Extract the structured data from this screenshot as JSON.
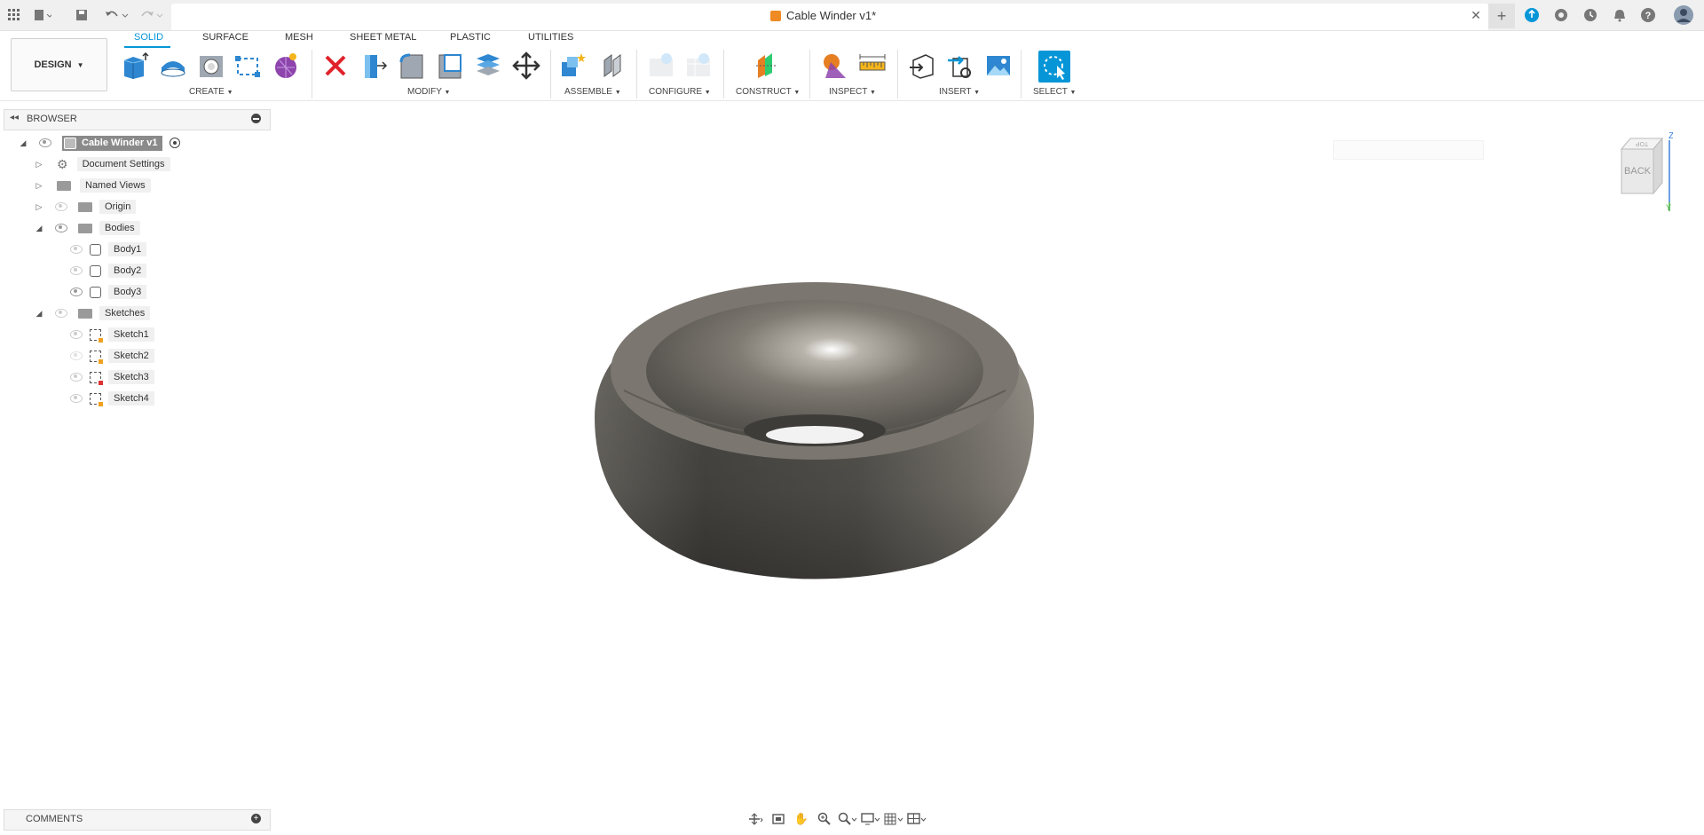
{
  "window": {
    "document_title": "Cable Winder v1*"
  },
  "workspace": {
    "design_label": "DESIGN"
  },
  "tabs": [
    {
      "label": "SOLID",
      "active": true
    },
    {
      "label": "SURFACE",
      "active": false
    },
    {
      "label": "MESH",
      "active": false
    },
    {
      "label": "SHEET METAL",
      "active": false
    },
    {
      "label": "PLASTIC",
      "active": false
    },
    {
      "label": "UTILITIES",
      "active": false
    }
  ],
  "toolbar_groups": {
    "create": "CREATE",
    "modify": "MODIFY",
    "assemble": "ASSEMBLE",
    "configure": "CONFIGURE",
    "construct": "CONSTRUCT",
    "inspect": "INSPECT",
    "insert": "INSERT",
    "select": "SELECT"
  },
  "browser": {
    "title": "BROWSER",
    "root": "Cable Winder v1",
    "items": [
      {
        "label": "Document Settings"
      },
      {
        "label": "Named Views"
      },
      {
        "label": "Origin"
      },
      {
        "label": "Bodies"
      },
      {
        "label": "Body1"
      },
      {
        "label": "Body2"
      },
      {
        "label": "Body3"
      },
      {
        "label": "Sketches"
      },
      {
        "label": "Sketch1"
      },
      {
        "label": "Sketch2"
      },
      {
        "label": "Sketch3"
      },
      {
        "label": "Sketch4"
      }
    ]
  },
  "comments": {
    "title": "COMMENTS"
  },
  "viewcube": {
    "face_label": "BACK",
    "top_label": "TOP",
    "axis_z": "Z",
    "axis_y": "Y"
  },
  "colors": {
    "accent": "#0696d7",
    "title_bar": "#f0f0f0",
    "model_dark": "#4a4843",
    "model_light": "#8f8a82"
  }
}
